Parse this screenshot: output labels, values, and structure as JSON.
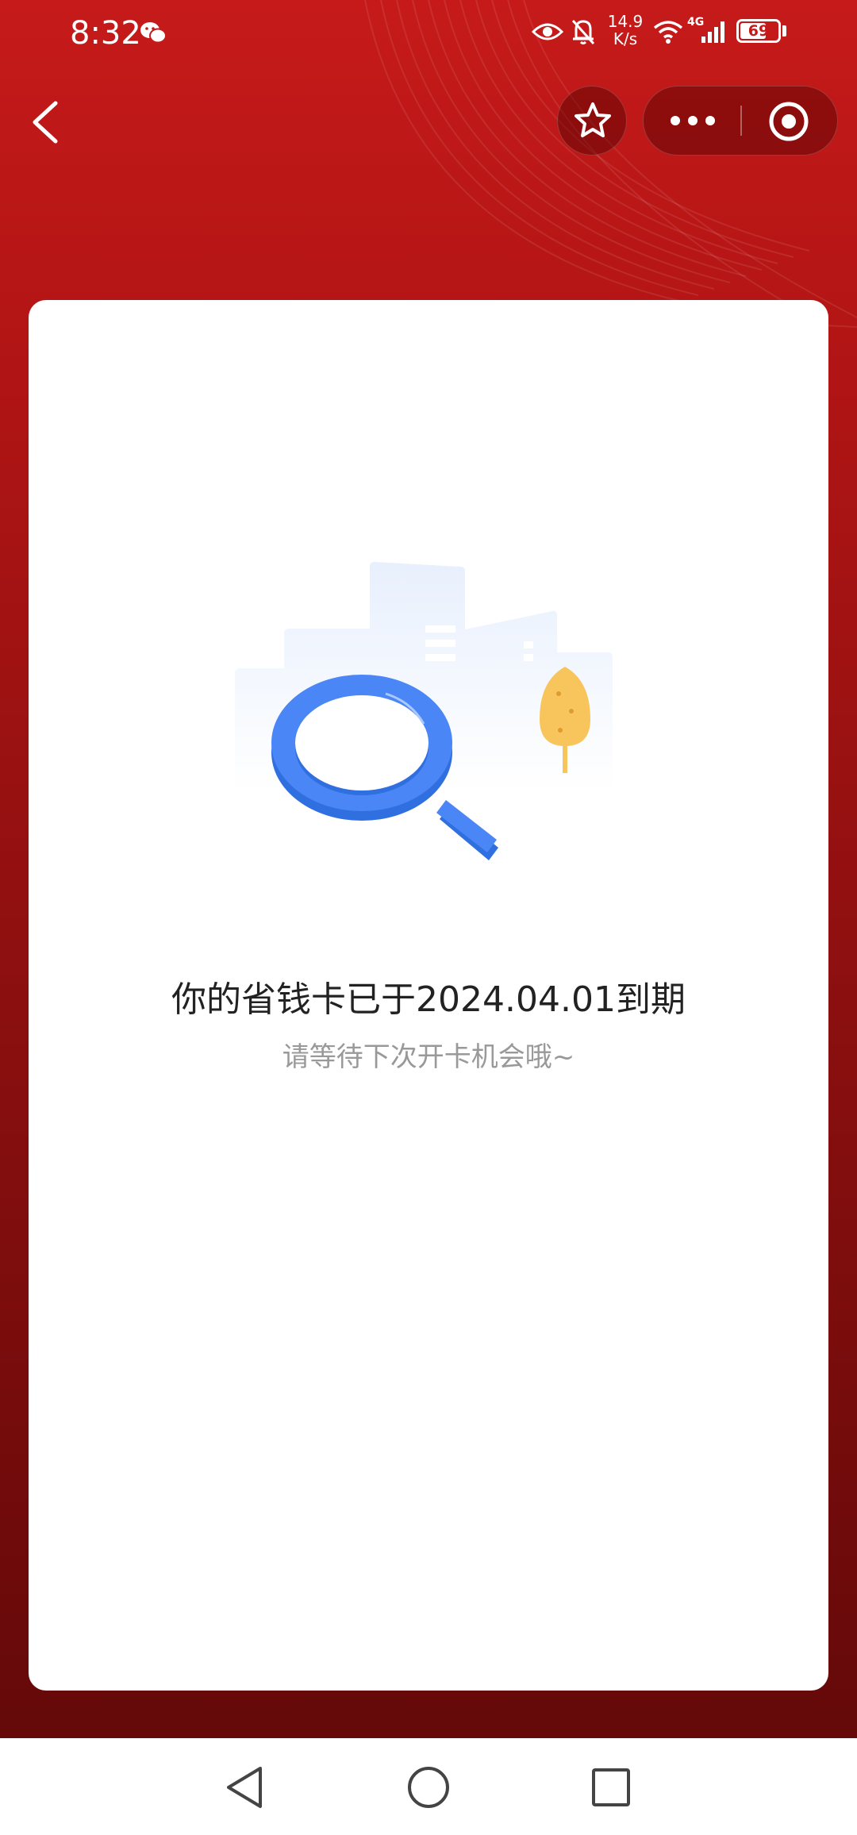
{
  "status_bar": {
    "time": "8:32",
    "network_speed_value": "14.9",
    "network_speed_unit": "K/s",
    "signal_label": "4G",
    "battery_level": "69",
    "icons": [
      "wechat-icon",
      "eye-icon",
      "bell-muted-icon",
      "wifi-icon",
      "signal-icon",
      "battery-icon"
    ]
  },
  "nav": {
    "icons": [
      "back-icon",
      "star-icon",
      "more-icon",
      "close-target-icon"
    ]
  },
  "empty_state": {
    "title": "你的省钱卡已于2024.04.01到期",
    "subtitle": "请等待下次开卡机会哦~",
    "illustration": "magnifier-empty-illustration"
  },
  "system_nav": {
    "icons": [
      "back-triangle-icon",
      "home-circle-icon",
      "recents-square-icon"
    ]
  },
  "colors": {
    "header_red": "#c61a1a",
    "bottom_red": "#650909",
    "card_bg": "#ffffff",
    "title_text": "#222222",
    "subtitle_text": "#999999",
    "magnifier_blue": "#4a86f5",
    "tree_yellow": "#f7c55c"
  }
}
